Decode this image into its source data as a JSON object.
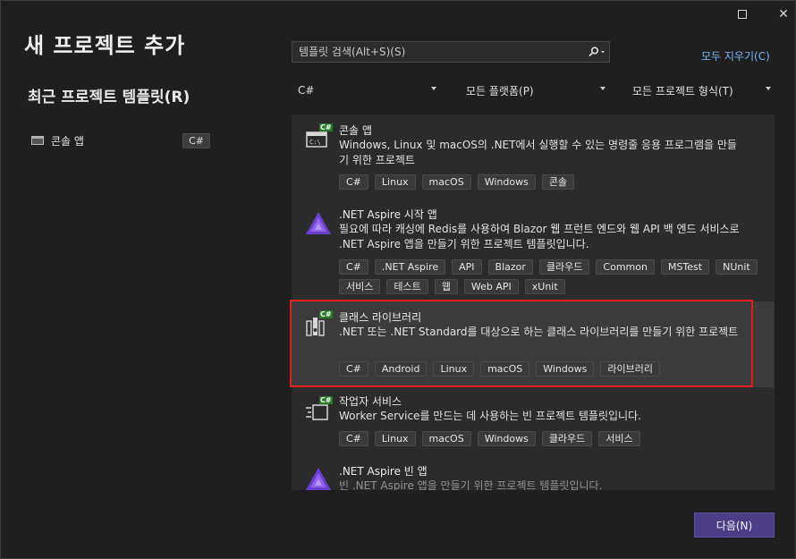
{
  "window": {
    "maximize_icon": "maximize-icon",
    "close_icon": "close-icon",
    "close_glyph": "✕"
  },
  "title": "새 프로젝트 추가",
  "recent": {
    "heading": "최근 프로젝트 템플릿(R)",
    "items": [
      {
        "label": "콘솔 앱",
        "lang": "C#",
        "icon": "console-icon"
      }
    ]
  },
  "search": {
    "placeholder": "템플릿 검색(Alt+S)(S)",
    "value": "",
    "icon": "search-icon"
  },
  "clear_all": "모두 지우기(C)",
  "filters": {
    "language": "C#",
    "platform": "모든 플랫폼(P)",
    "project_type": "모든 프로젝트 형식(T)"
  },
  "templates": [
    {
      "name": "콘솔 앱",
      "description": "Windows, Linux 및 macOS의 .NET에서 실행할 수 있는 명령줄 응용 프로그램을 만들기 위한 프로젝트",
      "icon": "console-app-icon",
      "tags": [
        "C#",
        "Linux",
        "macOS",
        "Windows",
        "콘솔"
      ]
    },
    {
      "name": ".NET Aspire 시작 앱",
      "description": "필요에 따라 캐싱에 Redis를 사용하여 Blazor 웹 프런트 엔드와 웹 API 백 엔드 서비스로 .NET Aspire 앱을 만들기 위한 프로젝트 템플릿입니다.",
      "icon": "aspire-icon",
      "tags": [
        "C#",
        ".NET Aspire",
        "API",
        "Blazor",
        "클라우드",
        "Common",
        "MSTest",
        "NUnit",
        "서비스",
        "테스트",
        "웹",
        "Web API",
        "xUnit"
      ]
    },
    {
      "name": "클래스 라이브러리",
      "description": ".NET 또는 .NET Standard를 대상으로 하는 클래스 라이브러리를 만들기 위한 프로젝트",
      "icon": "class-library-icon",
      "selected": true,
      "tags": [
        "C#",
        "Android",
        "Linux",
        "macOS",
        "Windows",
        "라이브러리"
      ]
    },
    {
      "name": "작업자 서비스",
      "description": "Worker Service를 만드는 데 사용하는 빈 프로젝트 템플릿입니다.",
      "icon": "worker-service-icon",
      "tags": [
        "C#",
        "Linux",
        "macOS",
        "Windows",
        "클라우드",
        "서비스"
      ]
    },
    {
      "name": ".NET Aspire 빈 앱",
      "description": "빈 .NET Aspire 앱을 만들기 위한 프로젝트 템플릿입니다.",
      "icon": "aspire-icon",
      "tags": []
    }
  ],
  "cs_badge": "C#",
  "next_button": "다음(N)",
  "colors": {
    "background": "#1f1f1f",
    "list_background": "#2b2b2b",
    "selected_background": "#3b3b3b",
    "selection_outline": "#e21b1b",
    "accent_button": "#4b3d86",
    "link": "#7ab4f5"
  }
}
